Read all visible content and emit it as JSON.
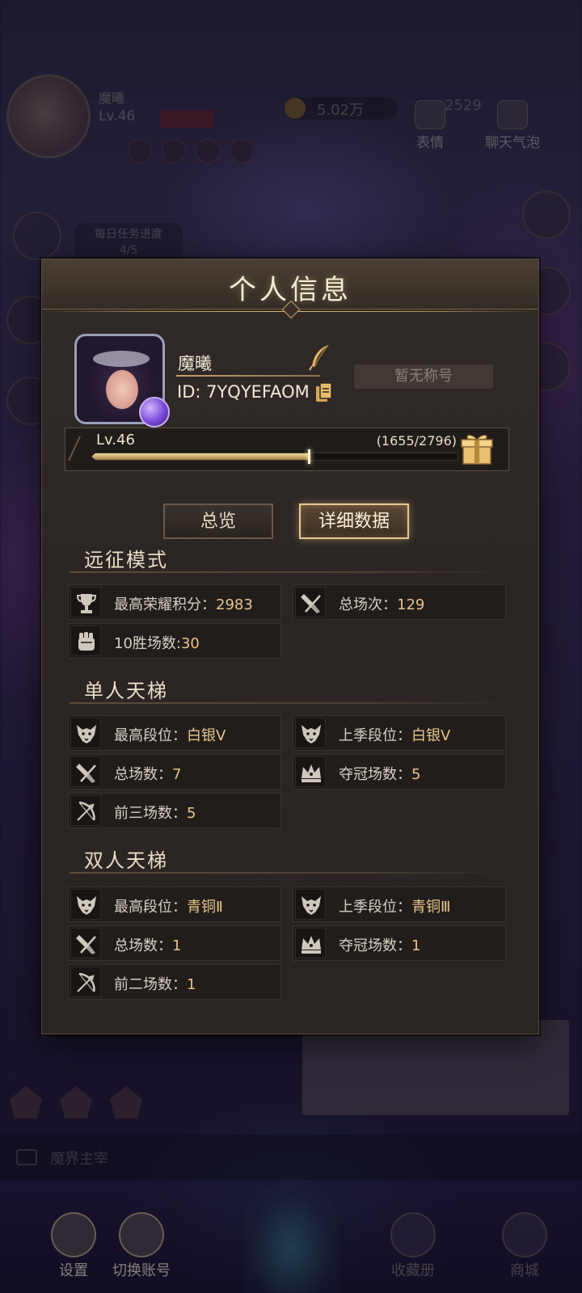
{
  "hud": {
    "name": "魔曦",
    "level": "Lv.46",
    "coins": "5.02万",
    "gems": "2529",
    "emote_label": "表情",
    "bubble_label": "聊天气泡",
    "daily_task": "每日任务进度",
    "daily_task_progress": "4/5"
  },
  "chat": {
    "channel_text": "魔界主宰"
  },
  "bottom_nav": {
    "settings": "设置",
    "switch_account": "切换账号",
    "collection": "收藏册",
    "shop": "商城"
  },
  "panel": {
    "title": "个人信息",
    "player": {
      "name": "魔曦",
      "id": "ID: 7YQYEFAOM",
      "title_placeholder": "暂无称号"
    },
    "level": {
      "label": "Lv.46",
      "exp_text": "(1655/2796)",
      "exp_current": 1655,
      "exp_max": 2796
    },
    "tabs": [
      {
        "label": "总览",
        "active": false
      },
      {
        "label": "详细数据",
        "active": true
      }
    ],
    "sections": {
      "expedition": {
        "title": "远征模式",
        "stats": [
          {
            "label": "最高荣耀积分：",
            "value": "2983",
            "icon": "trophy-icon"
          },
          {
            "label": "总场次：",
            "value": "129",
            "icon": "broom-icon"
          },
          {
            "label": "10胜场数:",
            "value": "30",
            "icon": "fist-icon"
          }
        ]
      },
      "solo": {
        "title": "单人天梯",
        "stats": [
          {
            "label": "最高段位：",
            "value": "白银Ⅴ",
            "icon": "wolf-icon"
          },
          {
            "label": "上季段位：",
            "value": "白银Ⅴ",
            "icon": "wolf-icon"
          },
          {
            "label": "总场数：",
            "value": "7",
            "icon": "broom-icon"
          },
          {
            "label": "夺冠场数：",
            "value": "5",
            "icon": "crown-icon"
          },
          {
            "label": "前三场数：",
            "value": "5",
            "icon": "bow-icon"
          }
        ]
      },
      "duo": {
        "title": "双人天梯",
        "stats": [
          {
            "label": "最高段位：",
            "value": "青铜Ⅱ",
            "icon": "wolf-icon"
          },
          {
            "label": "上季段位：",
            "value": "青铜Ⅲ",
            "icon": "wolf-icon"
          },
          {
            "label": "总场数：",
            "value": "1",
            "icon": "broom-icon"
          },
          {
            "label": "夺冠场数：",
            "value": "1",
            "icon": "crown-icon"
          },
          {
            "label": "前二场数：",
            "value": "1",
            "icon": "bow-icon"
          }
        ]
      }
    }
  },
  "colors": {
    "accent_gold": "#e8c58a",
    "panel_bg": "#2b2624",
    "exp_fill": "#c8a46a"
  }
}
